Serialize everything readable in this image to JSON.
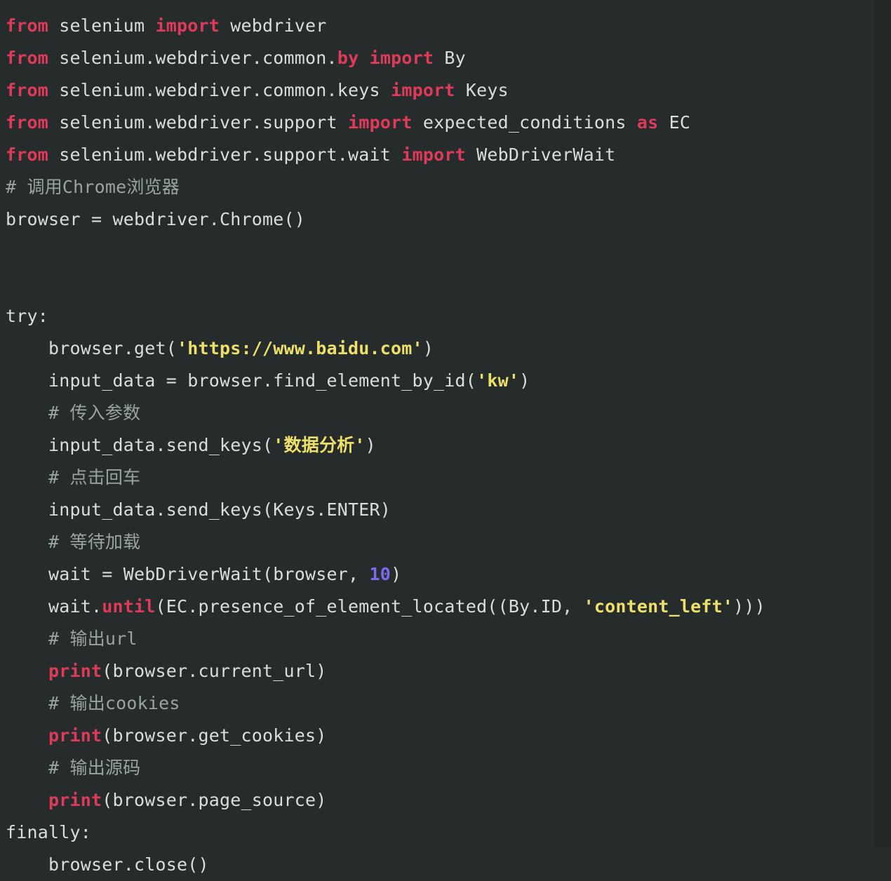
{
  "editor": {
    "language": "python",
    "theme_name": "dark",
    "colors": {
      "background": "#262b2b",
      "right_edge": "#222727",
      "plain_text": "#d8dede",
      "keyword": "#e03a5a",
      "comment": "#9aa3a3",
      "string": "#ede06a",
      "number": "#7a6cf0",
      "function": "#e03a5a"
    }
  },
  "code": {
    "lines": [
      {
        "n": 1,
        "tokens": [
          {
            "t": "from",
            "c": "kw"
          },
          {
            "t": " selenium ",
            "c": "plain"
          },
          {
            "t": "import",
            "c": "kw"
          },
          {
            "t": " webdriver",
            "c": "plain"
          }
        ]
      },
      {
        "n": 2,
        "tokens": [
          {
            "t": "from",
            "c": "kw"
          },
          {
            "t": " selenium.webdriver.common.",
            "c": "plain"
          },
          {
            "t": "by",
            "c": "kw"
          },
          {
            "t": " ",
            "c": "plain"
          },
          {
            "t": "import",
            "c": "kw"
          },
          {
            "t": " By",
            "c": "plain"
          }
        ]
      },
      {
        "n": 3,
        "tokens": [
          {
            "t": "from",
            "c": "kw"
          },
          {
            "t": " selenium.webdriver.common.keys ",
            "c": "plain"
          },
          {
            "t": "import",
            "c": "kw"
          },
          {
            "t": " Keys",
            "c": "plain"
          }
        ]
      },
      {
        "n": 4,
        "tokens": [
          {
            "t": "from",
            "c": "kw"
          },
          {
            "t": " selenium.webdriver.support ",
            "c": "plain"
          },
          {
            "t": "import",
            "c": "kw"
          },
          {
            "t": " expected_conditions ",
            "c": "plain"
          },
          {
            "t": "as",
            "c": "kw"
          },
          {
            "t": " EC",
            "c": "plain"
          }
        ]
      },
      {
        "n": 5,
        "tokens": [
          {
            "t": "from",
            "c": "kw"
          },
          {
            "t": " selenium.webdriver.support.wait ",
            "c": "plain"
          },
          {
            "t": "import",
            "c": "kw"
          },
          {
            "t": " WebDriverWait",
            "c": "plain"
          }
        ]
      },
      {
        "n": 6,
        "tokens": [
          {
            "t": "# 调用Chrome浏览器",
            "c": "com"
          }
        ]
      },
      {
        "n": 7,
        "tokens": [
          {
            "t": "browser = webdriver.Chrome()",
            "c": "plain"
          }
        ]
      },
      {
        "n": 8,
        "tokens": []
      },
      {
        "n": 9,
        "tokens": []
      },
      {
        "n": 10,
        "tokens": [
          {
            "t": "try:",
            "c": "plain"
          }
        ]
      },
      {
        "n": 11,
        "tokens": [
          {
            "t": "    browser.get(",
            "c": "plain"
          },
          {
            "t": "'https://www.baidu.com'",
            "c": "str"
          },
          {
            "t": ")",
            "c": "plain"
          }
        ]
      },
      {
        "n": 12,
        "tokens": [
          {
            "t": "    input_data = browser.find_element_by_id(",
            "c": "plain"
          },
          {
            "t": "'kw'",
            "c": "str"
          },
          {
            "t": ")",
            "c": "plain"
          }
        ]
      },
      {
        "n": 13,
        "tokens": [
          {
            "t": "    # 传入参数",
            "c": "com"
          }
        ]
      },
      {
        "n": 14,
        "tokens": [
          {
            "t": "    input_data.send_keys(",
            "c": "plain"
          },
          {
            "t": "'数据分析'",
            "c": "str"
          },
          {
            "t": ")",
            "c": "plain"
          }
        ]
      },
      {
        "n": 15,
        "tokens": [
          {
            "t": "    # 点击回车",
            "c": "com"
          }
        ]
      },
      {
        "n": 16,
        "tokens": [
          {
            "t": "    input_data.send_keys(Keys.ENTER)",
            "c": "plain"
          }
        ]
      },
      {
        "n": 17,
        "tokens": [
          {
            "t": "    # 等待加载",
            "c": "com"
          }
        ]
      },
      {
        "n": 18,
        "tokens": [
          {
            "t": "    wait = WebDriverWait(browser, ",
            "c": "plain"
          },
          {
            "t": "10",
            "c": "num"
          },
          {
            "t": ")",
            "c": "plain"
          }
        ]
      },
      {
        "n": 19,
        "tokens": [
          {
            "t": "    wait.",
            "c": "plain"
          },
          {
            "t": "until",
            "c": "fn"
          },
          {
            "t": "(EC.presence_of_element_located((By.ID, ",
            "c": "plain"
          },
          {
            "t": "'content_left'",
            "c": "str"
          },
          {
            "t": ")))",
            "c": "plain"
          }
        ]
      },
      {
        "n": 20,
        "tokens": [
          {
            "t": "    # 输出url",
            "c": "com"
          }
        ]
      },
      {
        "n": 21,
        "tokens": [
          {
            "t": "    ",
            "c": "plain"
          },
          {
            "t": "print",
            "c": "fn"
          },
          {
            "t": "(browser.current_url)",
            "c": "plain"
          }
        ]
      },
      {
        "n": 22,
        "tokens": [
          {
            "t": "    # 输出cookies",
            "c": "com"
          }
        ]
      },
      {
        "n": 23,
        "tokens": [
          {
            "t": "    ",
            "c": "plain"
          },
          {
            "t": "print",
            "c": "fn"
          },
          {
            "t": "(browser.get_cookies)",
            "c": "plain"
          }
        ]
      },
      {
        "n": 24,
        "tokens": [
          {
            "t": "    # 输出源码",
            "c": "com"
          }
        ]
      },
      {
        "n": 25,
        "tokens": [
          {
            "t": "    ",
            "c": "plain"
          },
          {
            "t": "print",
            "c": "fn"
          },
          {
            "t": "(browser.page_source)",
            "c": "plain"
          }
        ]
      },
      {
        "n": 26,
        "tokens": [
          {
            "t": "finally:",
            "c": "plain"
          }
        ]
      },
      {
        "n": 27,
        "tokens": [
          {
            "t": "    browser.close()",
            "c": "plain"
          }
        ]
      }
    ]
  }
}
